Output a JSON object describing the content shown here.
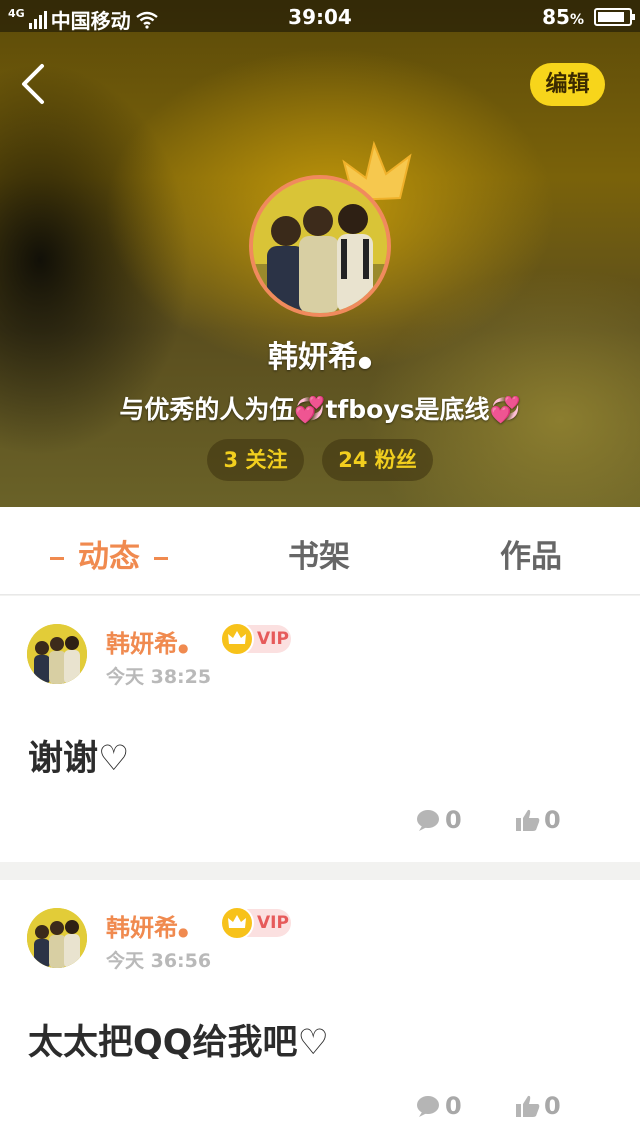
{
  "status_bar": {
    "network": "4G",
    "carrier": "中国移动",
    "time": "39:04",
    "battery_percent": "85",
    "battery_level": 0.85
  },
  "profile": {
    "back_icon": "chevron-left-icon",
    "edit_label": "编辑",
    "username": "韩妍希",
    "bio": "与优秀的人为伍💞tfboys是底线💞",
    "following_label": "3 关注",
    "fans_label": "24 粉丝"
  },
  "tabs": [
    {
      "label": "动态",
      "active": true
    },
    {
      "label": "书架",
      "active": false
    },
    {
      "label": "作品",
      "active": false
    }
  ],
  "posts": [
    {
      "author": "韩妍希",
      "vip": "VIP",
      "time": "今天 38:25",
      "content": "谢谢♡",
      "comments": "0",
      "likes": "0"
    },
    {
      "author": "韩妍希",
      "vip": "VIP",
      "time": "今天 36:56",
      "content": "太太把QQ给我吧♡",
      "comments": "0",
      "likes": "0"
    }
  ],
  "colors": {
    "accent_orange": "#f08a4f",
    "edit_yellow": "#f7d51b",
    "stat_text": "#f2cf1e",
    "vip_red": "#e65a5a"
  }
}
